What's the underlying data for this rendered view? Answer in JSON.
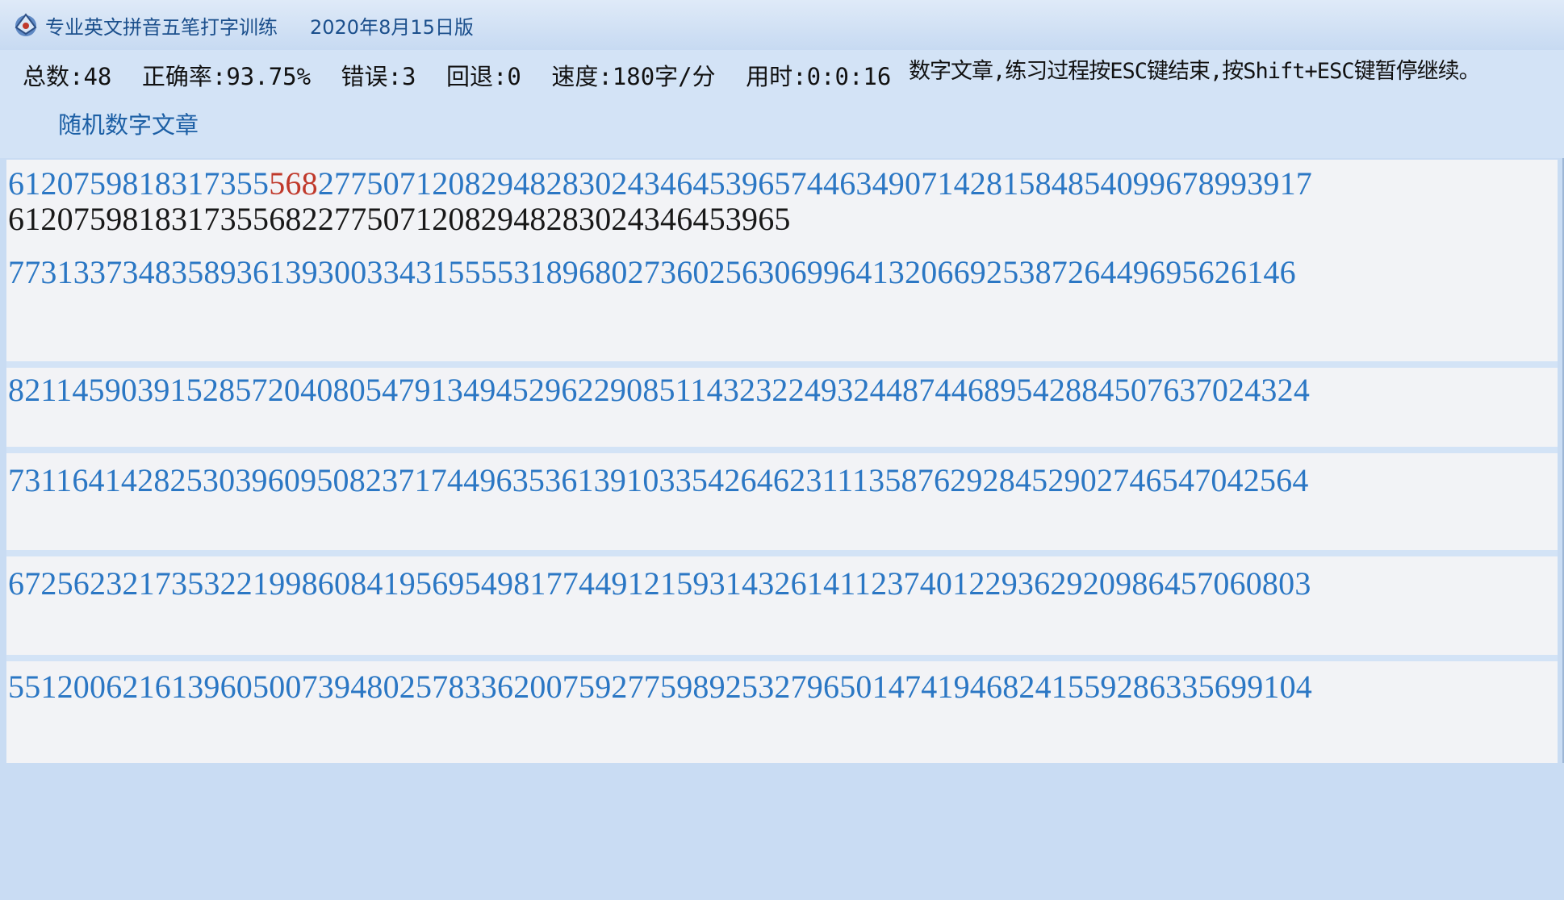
{
  "title": {
    "app_name": "专业英文拼音五笔打字训练",
    "version": "2020年8月15日版"
  },
  "stats": {
    "total": "总数:48",
    "accuracy": "正确率:93.75%",
    "errors": "错误:3",
    "backspaces": "回退:0",
    "speed": "速度:180字/分",
    "elapsed": "用时:0:0:16"
  },
  "instruction": "数字文章,练习过程按ESC键结束,按Shift+ESC键暂停继续。",
  "article_link": "随机数字文章",
  "lines": [
    {
      "source_before": "6120759818317355",
      "source_error": "568",
      "source_after": "277507120829482830243464539657446349071428158485409967899391​7",
      "typed": "6120759818317355682277507120829482830243464539​65"
    },
    {
      "source": "7731337348358936139300334315555318968027360256306996413206692538726449695626146",
      "typed": ""
    },
    {
      "source": "8211459039152857204080547913494529622908511432322493244874468954288450763702432​4",
      "typed": ""
    },
    {
      "source": "7311641428253039609508237174496353613910335426462311135876292845290274654704256​4",
      "typed": ""
    },
    {
      "source": "6725623217353221998608419569549817744912159314326141123740122936292098645706080​3",
      "typed": ""
    },
    {
      "source": "5512006216139605007394802578336200759277598925327965014741946824155928633569910​4",
      "typed": ""
    }
  ],
  "colors": {
    "source_text": "#2b77c4",
    "typed_text": "#181818",
    "error_text": "#c0392b",
    "chrome": "#c9dcf3"
  }
}
